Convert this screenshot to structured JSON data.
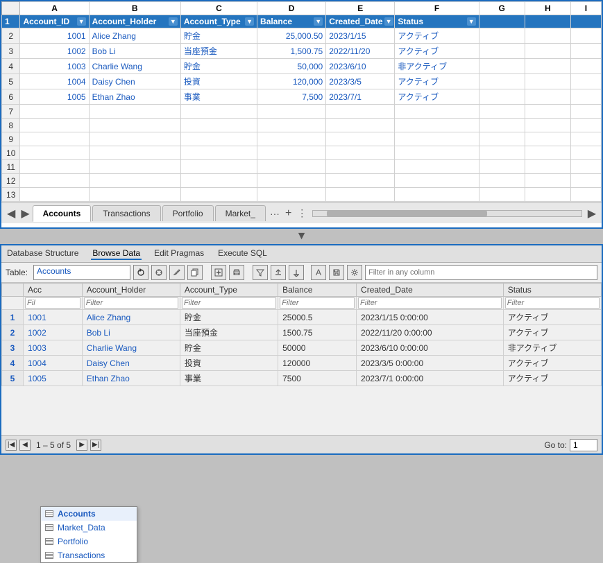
{
  "topSection": {
    "columns": [
      {
        "label": "A",
        "header": "Account_ID",
        "class": "col-a"
      },
      {
        "label": "B",
        "header": "Account_Holder",
        "class": "col-b"
      },
      {
        "label": "C",
        "header": "Account_Type",
        "class": "col-c"
      },
      {
        "label": "D",
        "header": "Balance",
        "class": "col-d"
      },
      {
        "label": "E",
        "header": "Created_Date",
        "class": "col-e"
      },
      {
        "label": "F",
        "header": "Status",
        "class": "col-f"
      },
      {
        "label": "G",
        "header": "",
        "class": "col-g"
      },
      {
        "label": "H",
        "header": "",
        "class": "col-h"
      },
      {
        "label": "I",
        "header": "",
        "class": "col-i"
      }
    ],
    "rows": [
      {
        "rowNum": 2,
        "data": [
          "1001",
          "Alice Zhang",
          "貯金",
          "25,000.50",
          "2023/1/15",
          "アクティブ",
          "",
          "",
          ""
        ]
      },
      {
        "rowNum": 3,
        "data": [
          "1002",
          "Bob Li",
          "当座預金",
          "1,500.75",
          "2022/11/20",
          "アクティブ",
          "",
          "",
          ""
        ]
      },
      {
        "rowNum": 4,
        "data": [
          "1003",
          "Charlie Wang",
          "貯金",
          "50,000",
          "2023/6/10",
          "非アクティブ",
          "",
          "",
          ""
        ]
      },
      {
        "rowNum": 5,
        "data": [
          "1004",
          "Daisy Chen",
          "投資",
          "120,000",
          "2023/3/5",
          "アクティブ",
          "",
          "",
          ""
        ]
      },
      {
        "rowNum": 6,
        "data": [
          "1005",
          "Ethan Zhao",
          "事業",
          "7,500",
          "2023/7/1",
          "アクティブ",
          "",
          "",
          ""
        ]
      }
    ],
    "emptyRows": [
      7,
      8,
      9,
      10,
      11,
      12,
      13
    ]
  },
  "tabs": {
    "items": [
      "Accounts",
      "Transactions",
      "Portfolio",
      "Market_"
    ],
    "active": "Accounts",
    "more": "···",
    "add": "+",
    "menu": ":"
  },
  "bottomSection": {
    "menuItems": [
      "Database Structure",
      "Browse Data",
      "Edit Pragmas",
      "Execute SQL"
    ],
    "activeMenu": "Browse Data",
    "toolbar": {
      "tableLabel": "Table:",
      "selectedTable": "Accounts",
      "filterPlaceholder": "Filter in any column"
    },
    "dropdown": {
      "items": [
        "Accounts",
        "Market_Data",
        "Portfolio",
        "Transactions"
      ],
      "selected": "Accounts"
    },
    "tableHeaders": [
      "Account_Holder",
      "Account_Type",
      "Balance",
      "Created_Date",
      "Status"
    ],
    "firstColHeader": "Acc",
    "filterRow": [
      "Filter",
      "Filter",
      "Filter",
      "Filter",
      "Filter"
    ],
    "rows": [
      {
        "rowNum": 1,
        "id": "1001",
        "data": [
          "Alice Zhang",
          "貯金",
          "25000.5",
          "2023/1/15 0:00:00",
          "アクティブ"
        ]
      },
      {
        "rowNum": 2,
        "id": "1002",
        "data": [
          "Bob Li",
          "当座預金",
          "1500.75",
          "2022/11/20 0:00:00",
          "アクティブ"
        ]
      },
      {
        "rowNum": 3,
        "id": "1003",
        "data": [
          "Charlie Wang",
          "貯金",
          "50000",
          "2023/6/10 0:00:00",
          "非アクティブ"
        ]
      },
      {
        "rowNum": 4,
        "id": "1004",
        "data": [
          "Daisy Chen",
          "投資",
          "120000",
          "2023/3/5 0:00:00",
          "アクティブ"
        ]
      },
      {
        "rowNum": 5,
        "id": "1005",
        "data": [
          "Ethan Zhao",
          "事業",
          "7500",
          "2023/7/1 0:00:00",
          "アクティブ"
        ]
      }
    ],
    "statusBar": {
      "recordCount": "1 – 5 of 5",
      "gotoLabel": "Go to:",
      "gotoValue": "1"
    }
  }
}
